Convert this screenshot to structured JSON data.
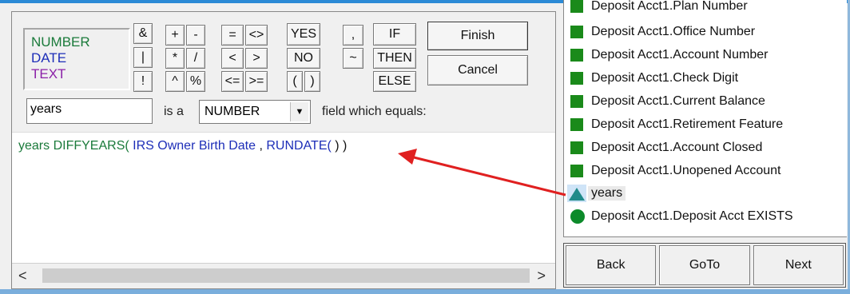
{
  "type_legend": {
    "number": "NUMBER",
    "date": "DATE",
    "text": "TEXT"
  },
  "operators": {
    "amp": "&",
    "pipe": "|",
    "bang": "!",
    "plus": "+",
    "minus": "-",
    "times": "*",
    "divide": "/",
    "power": "^",
    "percent": "%",
    "eq": "=",
    "neq": "<>",
    "lt": "<",
    "gt": ">",
    "lte": "<=",
    "gte": ">=",
    "yes": "YES",
    "no": "NO",
    "lparen": "(",
    "rparen": ")",
    "comma": ",",
    "tilde": "~",
    "if": "IF",
    "then": "THEN",
    "else": "ELSE"
  },
  "actions": {
    "finish": "Finish",
    "cancel": "Cancel"
  },
  "field_row": {
    "name_value": "years",
    "is_a_label": "is a",
    "type_value": "NUMBER",
    "which_equals_label": "field which equals:"
  },
  "expression": {
    "field": "years",
    "function": "DIFFYEARS(",
    "arg1": "IRS Owner Birth Date",
    "comma": ",",
    "arg2": "RUNDATE(",
    "close": ")  )"
  },
  "field_list": {
    "items": [
      {
        "label": "Deposit Acct1.Plan Number",
        "icon": "green-square-icon"
      },
      {
        "label": "Deposit Acct1.Office Number",
        "icon": "green-square-icon"
      },
      {
        "label": "Deposit Acct1.Account Number",
        "icon": "green-square-icon"
      },
      {
        "label": "Deposit Acct1.Check Digit",
        "icon": "green-square-icon"
      },
      {
        "label": "Deposit Acct1.Current Balance",
        "icon": "green-square-icon"
      },
      {
        "label": "Deposit Acct1.Retirement Feature",
        "icon": "green-square-icon"
      },
      {
        "label": "Deposit Acct1.Account Closed",
        "icon": "green-square-icon"
      },
      {
        "label": "Deposit Acct1.Unopened Account",
        "icon": "green-square-icon"
      },
      {
        "label": "years",
        "icon": "teal-triangle-icon"
      },
      {
        "label": "Deposit Acct1.Deposit Acct EXISTS",
        "icon": "green-circle-icon"
      }
    ]
  },
  "nav": {
    "back": "Back",
    "goto": "GoTo",
    "next": "Next"
  },
  "colors": {
    "number": "#1a7a3a",
    "date": "#1d2eb8",
    "text": "#8b21a8",
    "annotation_arrow": "#e02020",
    "field_square": "#1a8a1a",
    "calc_triangle": "#1f8a8a"
  }
}
